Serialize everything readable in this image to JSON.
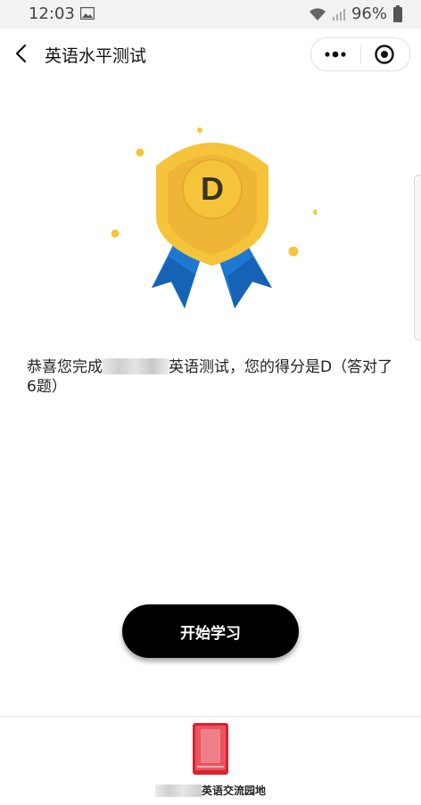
{
  "status_bar": {
    "time": "12:03",
    "battery": "96%"
  },
  "nav": {
    "title": "英语水平测试"
  },
  "medal": {
    "grade": "D"
  },
  "result": {
    "prefix": "恭喜您完成",
    "suffix": "英语测试，您的得分是D（答对了6题）"
  },
  "start_button": {
    "label": "开始学习"
  },
  "footer": {
    "label": "英语交流园地"
  },
  "colors": {
    "gold": "#f5c43a",
    "gold_dark": "#e9aa2e",
    "ribbon_blue": "#1e78d2",
    "button_black": "#000000"
  }
}
